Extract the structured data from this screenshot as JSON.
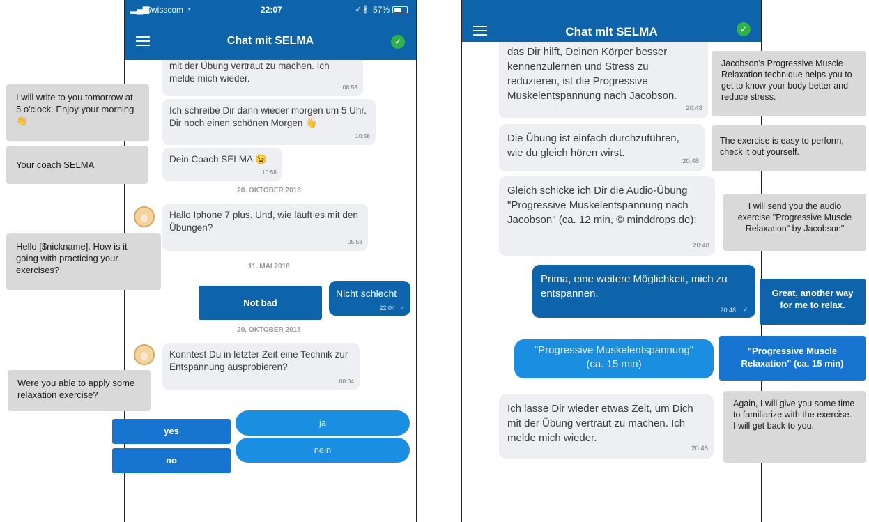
{
  "left": {
    "status_bar": {
      "carrier": "Swisscom",
      "time": "22:07",
      "battery": "57%"
    },
    "header": {
      "title": "Chat mit SELMA"
    },
    "messages": [
      {
        "text": "mit der Übung vertraut zu machen. Ich melde mich wieder.",
        "time": "08:58"
      },
      {
        "text": "Ich schreibe Dir dann wieder morgen um 5 Uhr. Dir noch einen schönen Morgen 👋",
        "time": "10:58"
      },
      {
        "text": "Dein Coach SELMA 😉",
        "time": "10:58"
      },
      {
        "text": "Hallo Iphone 7 plus. Und, wie läuft es mit den Übungen?",
        "time": "05:58"
      },
      {
        "text": "Konntest Du in letzter Zeit eine Technik zur Entspannung ausprobieren?",
        "time": "08:04"
      }
    ],
    "dates": [
      "20. OKTOBER 2018",
      "11. MAI 2018",
      "20. OKTOBER 2018"
    ],
    "user_message": {
      "text": "Nicht schlecht",
      "time": "22:04"
    },
    "quick_replies": {
      "ja": "ja",
      "nein": "nein"
    },
    "translations": {
      "t1": "I will write to you tomorrow at  5 o'clock. Enjoy your morning 👋",
      "t2": "Your coach SELMA",
      "t3": "Hello [$nickname]. How is it going with practicing your exercises?",
      "t4": "Not bad",
      "t5": "Were you able to apply some relaxation exercise?",
      "yes": "yes",
      "no": "no"
    }
  },
  "right": {
    "header": {
      "title": "Chat mit SELMA"
    },
    "messages": [
      {
        "text": "das Dir hilft, Deinen Körper besser kennenzulernen und Stress zu reduzieren, ist die Progressive Muskelentspannung nach Jacobson.",
        "time": "20:48"
      },
      {
        "text": "Die Übung ist einfach durchzuführen, wie du gleich hören wirst.",
        "time": "20:48"
      },
      {
        "text": "Gleich schicke ich Dir die Audio-Übung \"Progressive Muskelentspannung nach Jacobson\" (ca. 12 min, © minddrops.de):",
        "time": "20:48"
      },
      {
        "text": "Ich lasse Dir wieder etwas Zeit, um Dich mit der Übung vertraut zu machen. Ich melde mich wieder.",
        "time": "20:48"
      }
    ],
    "user_message": {
      "text": "Prima, eine weitere Möglichkeit, mich zu entspannen.",
      "time": "20:48"
    },
    "quick_reply": "\"Progressive Muskelentspannung\" (ca. 15 min)",
    "translations": {
      "t1": "Jacobson's Progressive Muscle Relaxation technique helps you to get to know your body better and reduce stress.",
      "t2": "The exercise is easy to perform, check it out yourself.",
      "t3": "I will send you the audio exercise \"Progressive Muscle Relaxation\" by Jacobson\"",
      "t4": "Great, another way for me to relax.",
      "t5": "\"Progressive Muscle Relaxation\" (ca. 15 min)",
      "t6": "Again, I will give you some time to familiarize with the exercise. I will get back to you."
    }
  },
  "colors": {
    "header": "#0e64ab",
    "check": "#2fb24a",
    "bubble": "#eeeff3",
    "translation": "#d9d9d9",
    "quick_reply": "#1a8ee0"
  }
}
